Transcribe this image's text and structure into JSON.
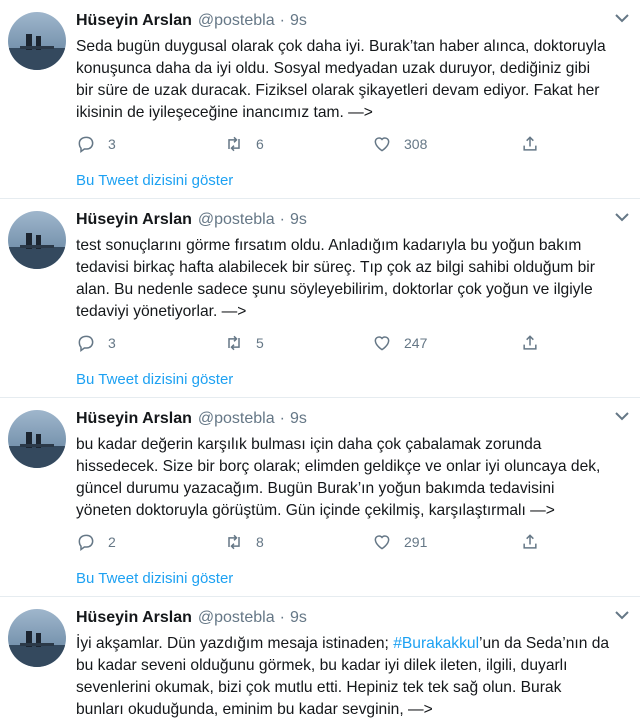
{
  "thread_link_label": "Bu Tweet dizisini göster",
  "tweets": [
    {
      "name": "Hüseyin Arslan",
      "handle": "@postebla",
      "dot": "·",
      "time": "9s",
      "lines": [
        "Seda bugün duygusal olarak çok daha iyi. Burak’tan haber alınca, doktoruyla",
        "konuşunca daha da iyi oldu. Sosyal medyadan uzak duruyor, dediğiniz gibi",
        "bir süre de uzak duracak. Fiziksel olarak şikayetleri devam ediyor. Fakat her",
        "ikisinin de iyileşeceğine inancımız tam. —>"
      ],
      "replies": "3",
      "retweets": "6",
      "likes": "308"
    },
    {
      "name": "Hüseyin Arslan",
      "handle": "@postebla",
      "dot": "·",
      "time": "9s",
      "lines": [
        "test sonuçlarını görme fırsatım oldu. Anladığım kadarıyla bu yoğun bakım",
        "tedavisi birkaç hafta alabilecek bir süreç. Tıp çok az bilgi sahibi olduğum bir",
        "alan. Bu nedenle sadece şunu söyleyebilirim, doktorlar çok yoğun ve ilgiyle",
        "tedaviyi yönetiyorlar. —>"
      ],
      "replies": "3",
      "retweets": "5",
      "likes": "247"
    },
    {
      "name": "Hüseyin Arslan",
      "handle": "@postebla",
      "dot": "·",
      "time": "9s",
      "lines": [
        "bu kadar değerin karşılık bulması için daha çok çabalamak zorunda",
        "hissedecek. Size bir borç olarak; elimden geldikçe ve onlar iyi oluncaya dek,",
        "güncel durumu yazacağım. Bugün Burak’ın yoğun bakımda tedavisini",
        "yöneten doktoruyla görüştüm. Gün içinde çekilmiş, karşılaştırmalı —>"
      ],
      "replies": "2",
      "retweets": "8",
      "likes": "291"
    },
    {
      "name": "Hüseyin Arslan",
      "handle": "@postebla",
      "dot": "·",
      "time": "9s",
      "line1_before": "İyi akşamlar. Dün yazdığım mesaja istinaden; ",
      "line1_hashtag": "#Burakakkul",
      "line1_after": "’un da Seda’nın da",
      "lines": [
        "bu kadar seveni olduğunu görmek, bu kadar iyi dilek ileten, ilgili, duyarlı",
        "sevenlerini okumak, bizi çok mutlu etti. Hepiniz tek tek sağ olun. Burak",
        "bunları okuduğunda, eminim bu kadar sevginin, —>"
      ]
    }
  ],
  "colors": {
    "accent": "#1da1f2",
    "muted": "#657786",
    "text": "#14171a",
    "divider": "#e6ecf0"
  },
  "icons": {
    "reply": "reply-icon",
    "retweet": "retweet-icon",
    "like": "heart-icon",
    "share": "share-icon",
    "caret": "chevron-down-icon"
  }
}
